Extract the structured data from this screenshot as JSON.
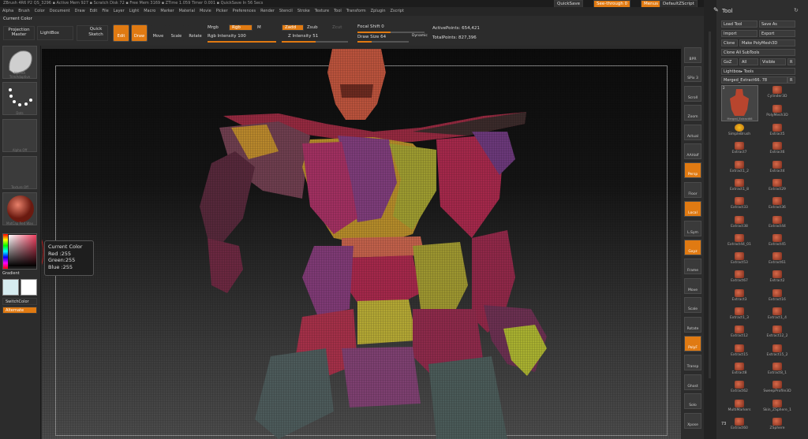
{
  "titlebar": {
    "text": "ZBrush 4R6 P2    QS_3296    ▪ Active Mem 927 ▪ Scratch Disk 72 ▪ Free Mem 3169 ▪ ZTime 1.059 Timer 0.001 ▪ QuickSave In 56 Secs",
    "quicksave": "QuickSave",
    "seethrough": "See-through  0",
    "menus": "Menus",
    "defaultzscript": "DefaultZScript"
  },
  "menubar": [
    "Alpha",
    "Brush",
    "Color",
    "Document",
    "Draw",
    "Edit",
    "File",
    "Layer",
    "Light",
    "Macro",
    "Marker",
    "Material",
    "Movie",
    "Picker",
    "Preferences",
    "Render",
    "Stencil",
    "Stroke",
    "Texture",
    "Tool",
    "Transform",
    "Zplugin",
    "Zscript"
  ],
  "toolbar": {
    "current_color": "Current Color",
    "projection_master": "Projection Master",
    "lightbox": "LightBox",
    "quick_sketch": "Quick Sketch",
    "edit": "Edit",
    "draw": "Draw",
    "move": "Move",
    "scale": "Scale",
    "rotate": "Rotate",
    "mrgb": "Mrgb",
    "rgb": "Rgb",
    "m": "M",
    "zadd": "Zadd",
    "zsub": "Zsub",
    "zcut": "Zcut",
    "rgb_intensity": "Rgb Intensity 100",
    "z_intensity": "Z Intensity 51",
    "focal_shift": "Focal Shift 0",
    "draw_size": "Draw Size 64",
    "dynamic": "Dynamic",
    "active_points": "ActivePoints: 654,421",
    "total_points": "TotalPoints: 827,396"
  },
  "leftshelf": {
    "brush": "Hpolish TrimAdaptive",
    "stroke": "Dots",
    "alpha": "Alpha Off",
    "texture": "Texture Off",
    "material": "MatCap Red Wax",
    "gradient": "Gradient",
    "switchcolor": "SwitchColor",
    "alternate": "Alternate"
  },
  "color_popup": {
    "title": "Current Color",
    "red": "Red :255",
    "green": "Green:255",
    "blue": "Blue :255"
  },
  "rightshelf": [
    "BPR",
    "SPix 3",
    "Scroll",
    "Zoom",
    "Actual",
    "AAHalf",
    "Persp",
    "Floor",
    "Local",
    "L.Sym",
    "Gxyz",
    "Frame",
    "Move",
    "Scale",
    "Rotate",
    "PolyF",
    "Transp",
    "Ghost",
    "Solo",
    "Xpose"
  ],
  "tool_palette": {
    "title": "Tool",
    "load_tool": "Load Tool",
    "save_as": "Save As",
    "import": "Import",
    "export": "Export",
    "clone": "Clone",
    "make_polymesh": "Make PolyMesh3D",
    "clone_all": "Clone All SubTools",
    "goz": "GoZ",
    "all": "All",
    "visible": "Visible",
    "r": "R",
    "lightbox_tools": "Lightbox▸ Tools",
    "current_tool": "Merged_Extract66. 78",
    "tools": [
      "Merged_Extract66",
      "Cylinder3D",
      "PolyMesh3D",
      "SimpleBrush",
      "Extract5",
      "Extract7",
      "Extract6",
      "Extract1_2",
      "Extract4",
      "Extract1_8",
      "Extract29",
      "Extract33",
      "Extract36",
      "Extract38",
      "Extract44",
      "Extract44_01",
      "Extract45",
      "Extract53",
      "Extract61",
      "Extract67",
      "Extract2",
      "Extract3",
      "Extract16",
      "Extract1_3",
      "Extract1_4",
      "Extract12",
      "Extract12_2",
      "Extract15",
      "Extract15_2",
      "Extract8",
      "Extract8_1",
      "Extract62",
      "SweepProfile3D",
      "MultiMarkers",
      "Skin_ZSphere_1",
      "Extract60",
      "ZSphere"
    ],
    "count": "73"
  }
}
